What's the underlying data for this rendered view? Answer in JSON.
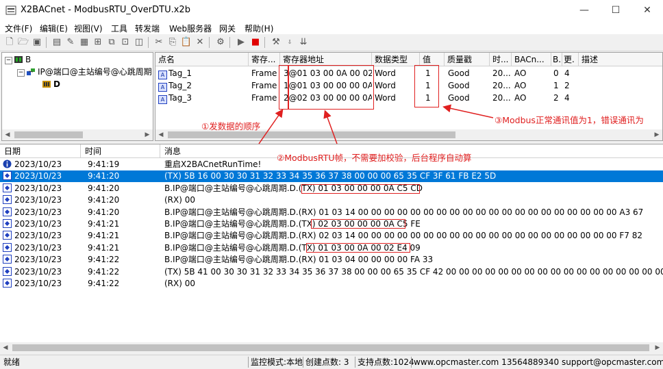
{
  "window": {
    "title": "X2BACnet - ModbusRTU_OverDTU.x2b",
    "minimize": "—",
    "maximize": "☐",
    "close": "✕"
  },
  "menu": [
    "文件(F)",
    "编辑(E)",
    "视图(V)",
    "工具",
    "转发端",
    "Web服务器",
    "网关",
    "帮助(H)"
  ],
  "tree": {
    "root": "B",
    "child": "IP@端口@主站编号@心跳周期",
    "leaf": "D"
  },
  "tag_table": {
    "headers": [
      "点名",
      "寄存...",
      "寄存器地址",
      "数据类型",
      "值",
      "质量戳",
      "时...",
      "BACn...",
      "B.",
      "更.",
      "描述"
    ],
    "rows": [
      [
        "Tag_1",
        "Frame",
        "3@01 03 00 0A 00 02",
        "Word",
        "1",
        "Good",
        "20...",
        "AO",
        "0",
        "4",
        ""
      ],
      [
        "Tag_2",
        "Frame",
        "1@01 03 00 00 00 0A",
        "Word",
        "1",
        "Good",
        "20...",
        "AO",
        "1",
        "2",
        ""
      ],
      [
        "Tag_3",
        "Frame",
        "2@02 03 00 00 00 0A",
        "Word",
        "1",
        "Good",
        "20...",
        "AO",
        "2",
        "4",
        ""
      ]
    ]
  },
  "annotations": {
    "a1": "①发数据的顺序",
    "a2": "②ModbusRTU帧，不需要加校验，后台程序自动算",
    "a3": "③Modbus正常通讯值为1，错误通讯为"
  },
  "log": {
    "headers": [
      "日期",
      "时间",
      "消息"
    ],
    "rows": [
      {
        "icon": "info-icon",
        "date": "2023/10/23",
        "time": "9:41:19",
        "msg": "重启X2BACnetRunTime!",
        "selected": false
      },
      {
        "icon": "comm-icon",
        "date": "2023/10/23",
        "time": "9:41:20",
        "msg": "(TX) 5B 16 00 30 30 31 32 33 34 35 36 37 38 00 00 00 65 35 CF 3F 61 FB E2 5D",
        "selected": true
      },
      {
        "icon": "comm-icon",
        "date": "2023/10/23",
        "time": "9:41:20",
        "msg": "B.IP@端口@主站编号@心跳周期.D.(TX) 01 03 00 00 00 0A C5 CD",
        "selected": false
      },
      {
        "icon": "comm-icon",
        "date": "2023/10/23",
        "time": "9:41:20",
        "msg": "(RX) 00",
        "selected": false
      },
      {
        "icon": "comm-icon",
        "date": "2023/10/23",
        "time": "9:41:20",
        "msg": "B.IP@端口@主站编号@心跳周期.D.(RX) 01 03 14 00 00 00 00 00 00 00 00 00 00 00 00 00 00 00 00 00 00 00 00 A3 67",
        "selected": false
      },
      {
        "icon": "comm-icon",
        "date": "2023/10/23",
        "time": "9:41:21",
        "msg": "B.IP@端口@主站编号@心跳周期.D.(TX) 02 03 00 00 00 0A C5 FE",
        "selected": false
      },
      {
        "icon": "comm-icon",
        "date": "2023/10/23",
        "time": "9:41:21",
        "msg": "B.IP@端口@主站编号@心跳周期.D.(RX) 02 03 14 00 00 00 00 00 00 00 00 00 00 00 00 00 00 00 00 00 00 00 00 F7 82",
        "selected": false
      },
      {
        "icon": "comm-icon",
        "date": "2023/10/23",
        "time": "9:41:21",
        "msg": "B.IP@端口@主站编号@心跳周期.D.(TX) 01 03 00 0A 00 02 E4 09",
        "selected": false
      },
      {
        "icon": "comm-icon",
        "date": "2023/10/23",
        "time": "9:41:22",
        "msg": "B.IP@端口@主站编号@心跳周期.D.(RX) 01 03 04 00 00 00 00 FA 33",
        "selected": false
      },
      {
        "icon": "comm-icon",
        "date": "2023/10/23",
        "time": "9:41:22",
        "msg": "(TX) 5B 41 00 30 30 31 32 33 34 35 36 37 38 00 00 00 65 35 CF 42 00 00 00 00 00 00 00 00 00 00 00 00 00 00 00 00 00 00",
        "selected": false
      },
      {
        "icon": "comm-icon",
        "date": "2023/10/23",
        "time": "9:41:22",
        "msg": "(RX) 00",
        "selected": false
      }
    ]
  },
  "status": {
    "ready": "就绪",
    "mode": "监控模式:本地",
    "created": "创建点数:  3",
    "supported": "支持点数:1024",
    "contact": "www.opcmaster.com 13564889340 support@opcmaster.com"
  },
  "colors": {
    "selection": "#0078d7",
    "annotation": "#e02020"
  }
}
